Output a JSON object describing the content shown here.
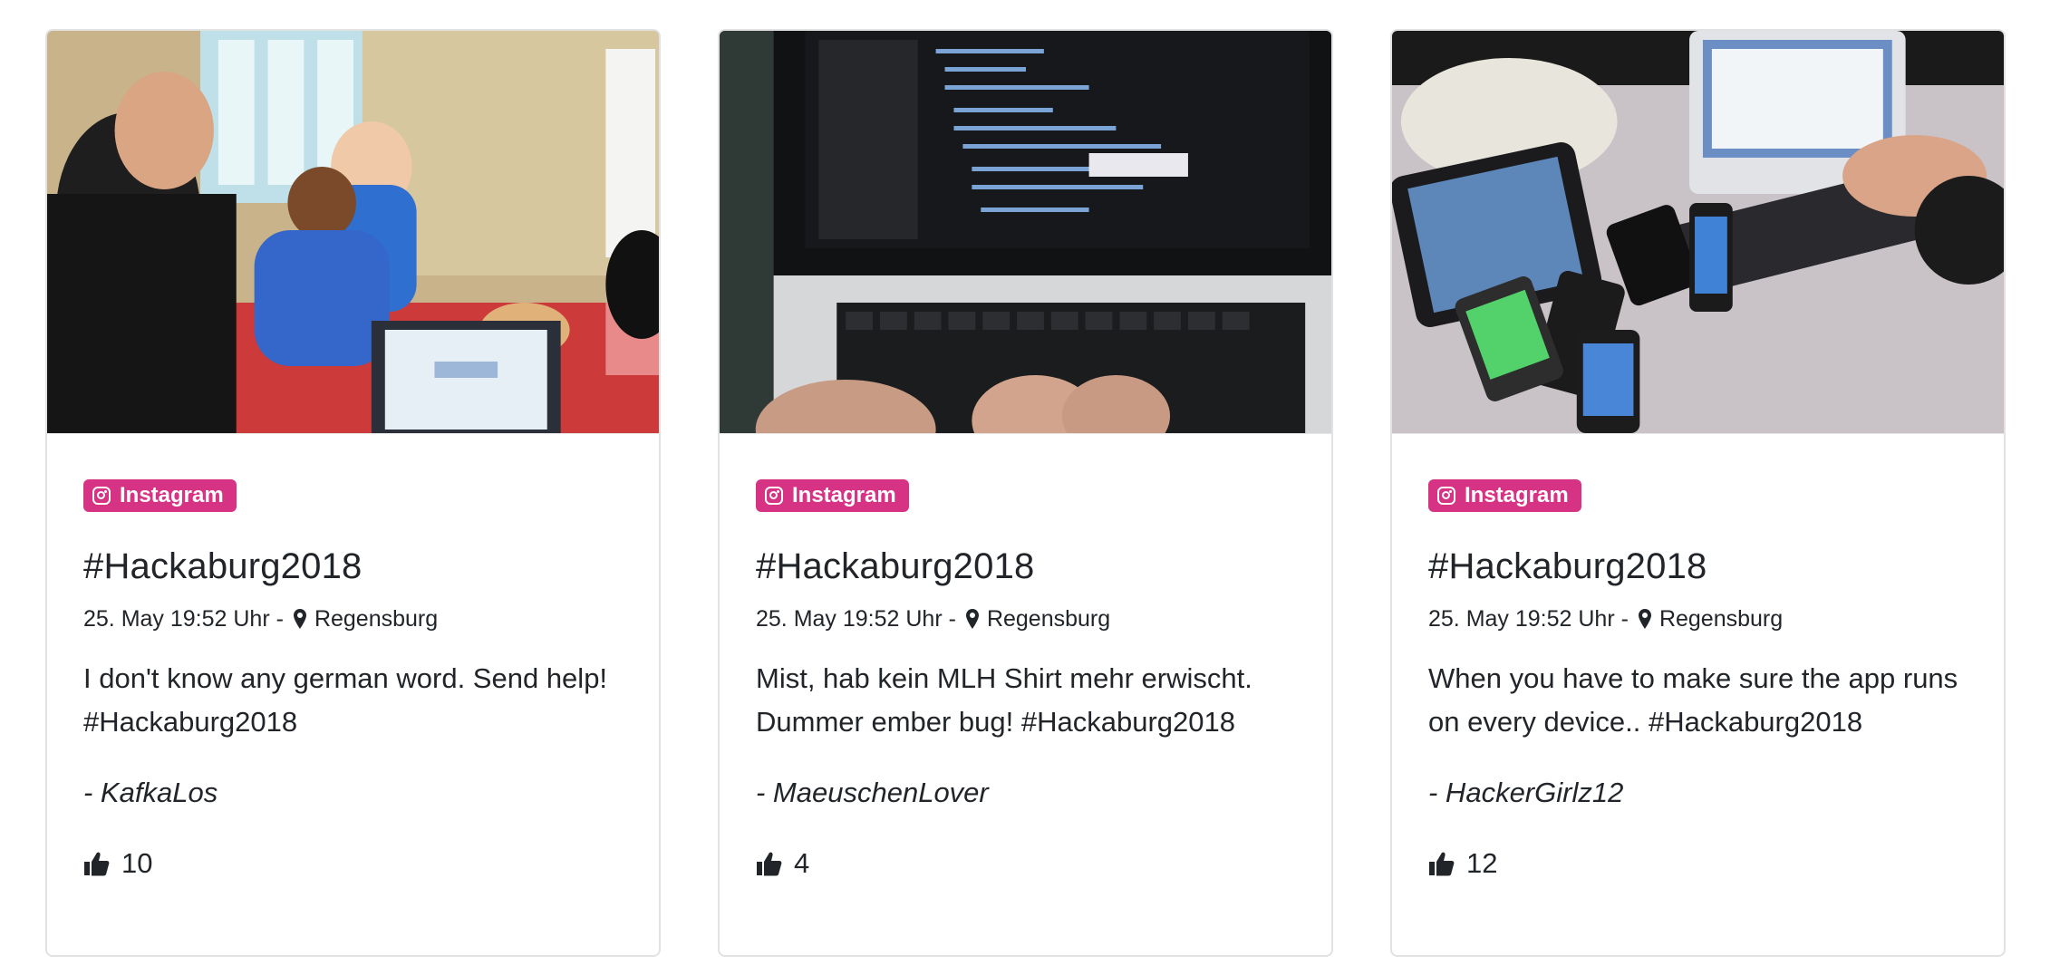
{
  "cards": [
    {
      "source_label": "Instagram",
      "title": "#Hackaburg2018",
      "date": "25. May 19:52 Uhr -",
      "location": "Regensburg",
      "text": "I don't know any german word. Send help! #Hackaburg2018",
      "author": "- KafkaLos",
      "likes": "10",
      "image_desc": "people-at-hackathon-photo"
    },
    {
      "source_label": "Instagram",
      "title": "#Hackaburg2018",
      "date": "25. May 19:52 Uhr -",
      "location": "Regensburg",
      "text": "Mist, hab kein MLH Shirt mehr erwischt. Dummer ember bug! #Hackaburg2018",
      "author": "- MaeuschenLover",
      "likes": "4",
      "image_desc": "laptop-coding-photo"
    },
    {
      "source_label": "Instagram",
      "title": "#Hackaburg2018",
      "date": "25. May 19:52 Uhr -",
      "location": "Regensburg",
      "text": "When you have to make sure the app runs on every device.. #Hackaburg2018",
      "author": "- HackerGirlz12",
      "likes": "12",
      "image_desc": "many-devices-photo"
    }
  ],
  "colors": {
    "badge": "#d63384",
    "border": "#e2e2e2",
    "text": "#212529"
  },
  "icons": {
    "badge": "instagram-icon",
    "location": "map-marker-icon",
    "likes": "thumbs-up-icon"
  }
}
